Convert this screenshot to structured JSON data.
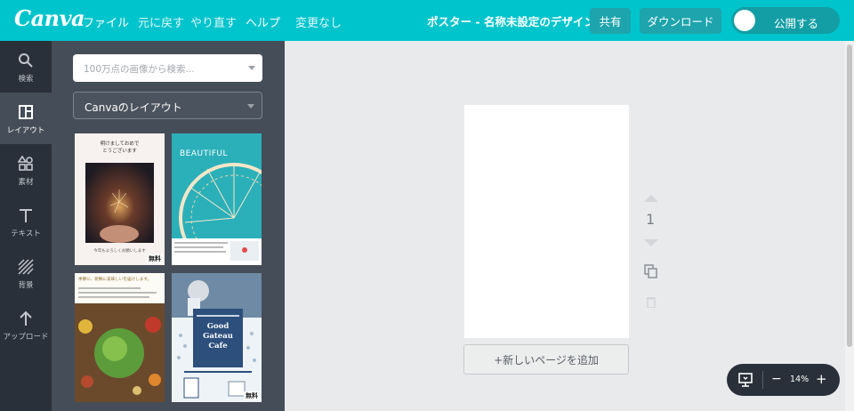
{
  "app": {
    "logo": "Canva"
  },
  "menu": {
    "file": "ファイル",
    "undo": "元に戻す",
    "redo": "やり直す",
    "help": "ヘルプ",
    "status": "変更なし"
  },
  "header": {
    "title": "ポスター - 名称未設定のデザイン",
    "share": "共有",
    "download": "ダウンロード",
    "publish": "公開する"
  },
  "rail": {
    "search": "検索",
    "layout": "レイアウト",
    "elements": "素材",
    "text": "テキスト",
    "background": "背景",
    "upload": "アップロード"
  },
  "panel": {
    "search_placeholder": "100万点の画像から検索...",
    "layout_select": "Canvaのレイアウト",
    "thumbs": [
      {
        "name": "sparkler",
        "text": "明けましておめで\nとうございます",
        "footer": "今年もよろしくお願いします",
        "badge": "無料"
      },
      {
        "name": "ferris",
        "text": "BEAUTIFUL",
        "badge": ""
      },
      {
        "name": "salad",
        "text": "季節に、新鮮に美味しいを届けします。",
        "badge": ""
      },
      {
        "name": "cafe",
        "text": "Good\nGateau\nCafe",
        "badge": "無料"
      }
    ]
  },
  "canvas": {
    "add_page": "+新しいページを追加",
    "page_number": "1"
  },
  "zoom": {
    "value": "14%",
    "minus": "−",
    "plus": "+"
  },
  "colors": {
    "brand": "#00c4cc",
    "rail": "#293039",
    "panel": "#454d58"
  }
}
